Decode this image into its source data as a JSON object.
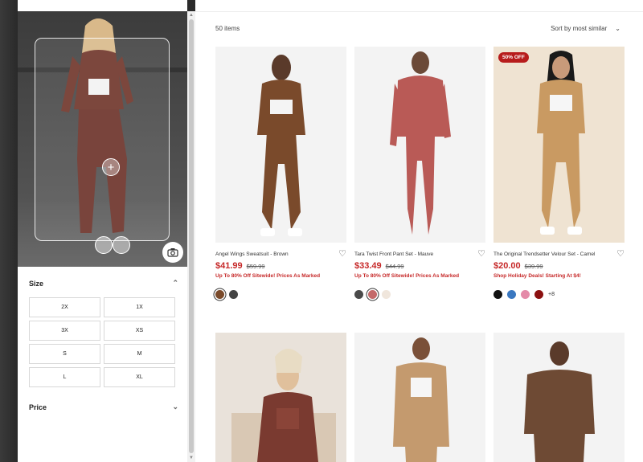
{
  "results": {
    "count_label": "50 items",
    "sort_label": "Sort by most similar"
  },
  "filters": {
    "size": {
      "title": "Size",
      "options": [
        "2X",
        "1X",
        "3X",
        "XS",
        "S",
        "M",
        "L",
        "XL"
      ]
    },
    "price": {
      "title": "Price"
    }
  },
  "products": [
    {
      "name": "Angel Wings Sweatsuit - Brown",
      "price": "$41.99",
      "original_price": "$59.99",
      "promo": "Up To 80% Off Sitewide! Prices As Marked",
      "swatches": [
        "#7a4a2b",
        "#444444"
      ],
      "selected_swatch": 0,
      "more": ""
    },
    {
      "name": "Tara Twist Front Pant  Set - Mauve",
      "price": "$33.49",
      "original_price": "$44.99",
      "promo": "Up To 80% Off Sitewide! Prices As Marked",
      "swatches": [
        "#4a4a4a",
        "#c46a6a",
        "#f0e6dc"
      ],
      "selected_swatch": 1,
      "more": ""
    },
    {
      "name": "The Original Trendsetter Velour Set - Camel",
      "price": "$20.00",
      "original_price": "$39.99",
      "promo": "Shop Holiday Deals! Starting At $4!",
      "badge": "50% OFF",
      "swatches": [
        "#111111",
        "#3a78c0",
        "#e48aa8",
        "#8b1010"
      ],
      "more": "+8"
    }
  ],
  "colors": {
    "accent_red": "#c62828",
    "badge_red": "#b71c1c"
  }
}
